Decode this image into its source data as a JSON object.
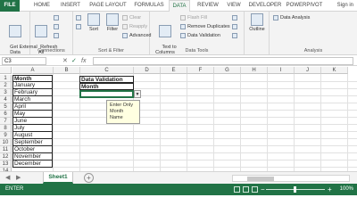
{
  "ribbon_tabs": [
    "FILE",
    "HOME",
    "INSERT",
    "PAGE LAYOUT",
    "FORMULAS",
    "DATA",
    "REVIEW",
    "VIEW",
    "DEVELOPER",
    "POWERPIVOT"
  ],
  "active_tab": "DATA",
  "sign_in": "Sign in",
  "groups": {
    "get_external": {
      "label": "Get External\nData"
    },
    "connections": {
      "refresh": "Refresh\nAll",
      "label": "Connections"
    },
    "sort_filter": {
      "sort": "Sort",
      "filter": "Filter",
      "clear": "Clear",
      "reapply": "Reapply",
      "advanced": "Advanced",
      "label": "Sort & Filter"
    },
    "data_tools": {
      "text_to_columns": "Text to\nColumns",
      "flash_fill": "Flash Fill",
      "remove_duplicates": "Remove Duplicates",
      "data_validation": "Data Validation",
      "label": "Data Tools"
    },
    "outline": {
      "label": "Outline"
    },
    "analysis": {
      "data_analysis": "Data Analysis",
      "label": "Analysis"
    }
  },
  "formula_bar": {
    "name_box": "C3",
    "fx": "fx",
    "value": ""
  },
  "columns": [
    "A",
    "B",
    "C",
    "D",
    "E",
    "F",
    "G",
    "H",
    "I",
    "J",
    "K"
  ],
  "rows": [
    "1",
    "2",
    "3",
    "4",
    "5",
    "6",
    "7",
    "8",
    "9",
    "10",
    "11",
    "12",
    "13",
    "14"
  ],
  "column_a": [
    "Month",
    "January",
    "February",
    "March",
    "April",
    "May",
    "June",
    "July",
    "August",
    "September",
    "October",
    "November",
    "December"
  ],
  "data_validation": {
    "title": "Data Validation",
    "header": "Month",
    "input_message": "Enter Only\nMonth\nName"
  },
  "sheet_tab": "Sheet1",
  "status": {
    "ready": "ENTER",
    "zoom": "100%"
  },
  "colors": {
    "accent": "#217346"
  }
}
